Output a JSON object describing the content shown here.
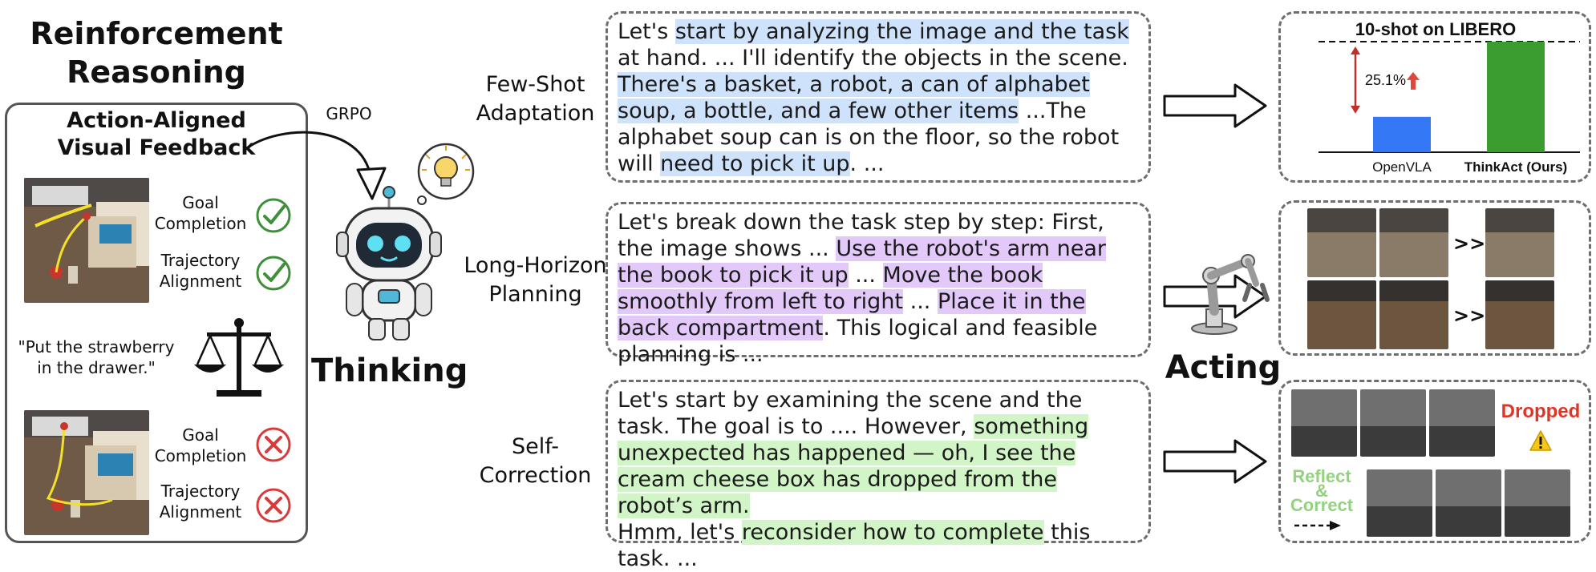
{
  "reinforcement": {
    "title_line1": "Reinforcement",
    "title_line2": "Reasoning",
    "feedback_title_line1": "Action-Aligned",
    "feedback_title_line2": "Visual Feedback",
    "grpo": "GRPO",
    "success": {
      "goal_line1": "Goal",
      "goal_line2": "Completion",
      "traj_line1": "Trajectory",
      "traj_line2": "Alignment"
    },
    "failure": {
      "goal_line1": "Goal",
      "goal_line2": "Completion",
      "traj_line1": "Trajectory",
      "traj_line2": "Alignment"
    },
    "instruction_line1": "\"Put the strawberry",
    "instruction_line2": "in the drawer.\""
  },
  "thinking": {
    "label": "Thinking"
  },
  "acting": {
    "label": "Acting"
  },
  "capabilities": [
    {
      "line1": "Few-Shot",
      "line2": "Adaptation"
    },
    {
      "line1": "Long-Horizon",
      "line2": "Planning"
    },
    {
      "line1": "Self-",
      "line2": "Correction"
    }
  ],
  "reasoning": {
    "fewshot": {
      "s1": "Let's ",
      "s2": "start by analyzing the image and the task",
      "s3": " at hand. ... I'll identify the objects in the scene. ",
      "s4": "There's a basket, a robot, a can of alphabet soup, a bottle, and a few other items",
      "s5": " ...The alphabet soup can is on the floor, so the robot will ",
      "s6": "need to pick it up",
      "s7": ". ..."
    },
    "longhorizon": {
      "s1": "Let's break down the task step by step: First, the image shows ... ",
      "s2": "Use the robot's arm near the book to pick it up",
      "s3": " ... ",
      "s4": "Move the book smoothly from left to right",
      "s5": " ... ",
      "s6": "Place it in the back compartment",
      "s7": ". This logical and feasible planning is ..."
    },
    "selfcorrection": {
      "s1": "Let's start by examining the scene and the task. The goal is to .... However, ",
      "s2": "something unexpected has happened — oh, I see the cream cheese box has dropped from the robot’s arm.",
      "s3": "Hmm, let's ",
      "s4": "reconsider how to complete",
      "s5": " this task. ..."
    }
  },
  "chart_data": {
    "type": "bar",
    "title": "10-shot on LIBERO",
    "categories": [
      "OpenVLA",
      "ThinkAct (Ours)"
    ],
    "values": [
      32,
      100
    ],
    "ylim": [
      0,
      110
    ],
    "annotation": "25.1%",
    "colors": [
      "#3478f6",
      "#3b9c2f"
    ],
    "note": "bar heights are relative; the printed improvement is 25.1%"
  },
  "results": {
    "dropped": "Dropped",
    "reflect_line1": "Reflect",
    "reflect_amp": "&",
    "reflect_line2": "Correct",
    "next_symbol": ">>"
  },
  "colors": {
    "check": "#3d8f3a",
    "cross": "#d93a3a",
    "dropped": "#e03526",
    "reflect": "#93d27f",
    "arrow_up": "#e0473a",
    "double_arrow": "#c0302a"
  }
}
